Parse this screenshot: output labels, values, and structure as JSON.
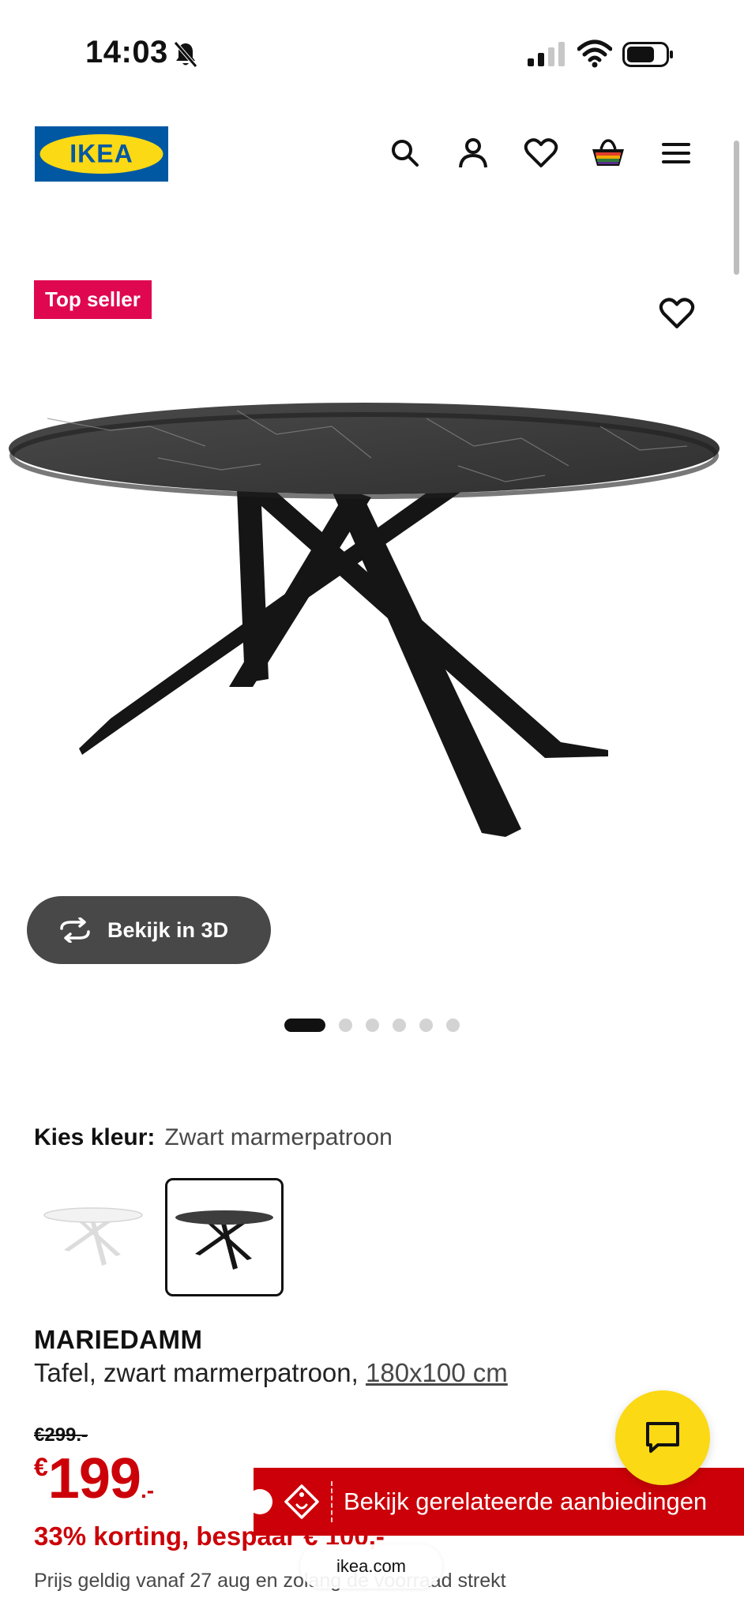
{
  "status_bar": {
    "time": "14:03"
  },
  "header": {
    "logo_text": "IKEA"
  },
  "product": {
    "badge": "Top seller",
    "view_3d_label": "Bekijk in 3D",
    "image_count": 6,
    "active_image": 1,
    "color_label": "Kies kleur:",
    "color_value": "Zwart marmerpatroon",
    "name": "MARIEDAMM",
    "description": "Tafel, zwart marmerpatroon, ",
    "size": "180x100 cm",
    "old_price": "€299.-",
    "price_currency": "€",
    "price_amount": "199",
    "price_decimals": ".-",
    "discount": "33% korting, bespaar € 100,-",
    "validity": "Prijs geldig vanaf 27 aug en zolang de voorraad strekt"
  },
  "overlays": {
    "deals_label": "Bekijk gerelateerde aanbiedingen",
    "url": "ikea.com"
  },
  "colors": {
    "ikea_blue": "#0058a3",
    "ikea_yellow": "#fbd914",
    "sale_red": "#cc0008",
    "badge_pink": "#e00751"
  }
}
